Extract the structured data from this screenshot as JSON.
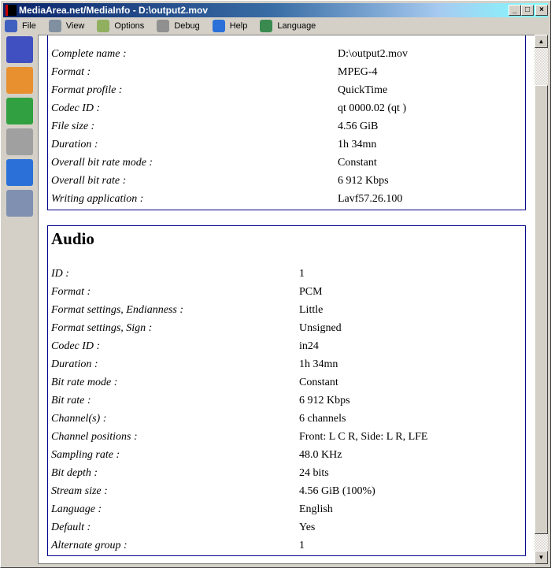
{
  "window": {
    "title": "MediaArea.net/MediaInfo - D:\\output2.mov",
    "minimize": "_",
    "maximize": "□",
    "close": "×"
  },
  "menu": [
    {
      "label": "File",
      "icon": "file-open-icon"
    },
    {
      "label": "View",
      "icon": "view-icon"
    },
    {
      "label": "Options",
      "icon": "options-icon"
    },
    {
      "label": "Debug",
      "icon": "debug-icon"
    },
    {
      "label": "Help",
      "icon": "help-icon"
    },
    {
      "label": "Language",
      "icon": "language-icon"
    }
  ],
  "toolbar": [
    "open-file-icon",
    "open-folder-icon",
    "export-icon",
    "preferences-icon",
    "about-icon",
    "knowledge-icon"
  ],
  "general": {
    "rows": [
      {
        "label": "Complete name :",
        "value": "D:\\output2.mov"
      },
      {
        "label": "Format :",
        "value": "MPEG-4"
      },
      {
        "label": "Format profile :",
        "value": "QuickTime"
      },
      {
        "label": "Codec ID :",
        "value": "qt 0000.02 (qt )"
      },
      {
        "label": "File size :",
        "value": "4.56 GiB"
      },
      {
        "label": "Duration :",
        "value": "1h 34mn"
      },
      {
        "label": "Overall bit rate mode :",
        "value": "Constant"
      },
      {
        "label": "Overall bit rate :",
        "value": "6 912 Kbps"
      },
      {
        "label": "Writing application :",
        "value": "Lavf57.26.100"
      }
    ]
  },
  "audio": {
    "heading": "Audio",
    "rows": [
      {
        "label": "ID :",
        "value": "1"
      },
      {
        "label": "Format :",
        "value": "PCM"
      },
      {
        "label": "Format settings, Endianness :",
        "value": "Little"
      },
      {
        "label": "Format settings, Sign :",
        "value": "Unsigned"
      },
      {
        "label": "Codec ID :",
        "value": "in24"
      },
      {
        "label": "Duration :",
        "value": "1h 34mn"
      },
      {
        "label": "Bit rate mode :",
        "value": "Constant"
      },
      {
        "label": "Bit rate :",
        "value": "6 912 Kbps"
      },
      {
        "label": "Channel(s) :",
        "value": "6 channels"
      },
      {
        "label": "Channel positions :",
        "value": "Front: L C R, Side: L R, LFE"
      },
      {
        "label": "Sampling rate :",
        "value": "48.0 KHz"
      },
      {
        "label": "Bit depth :",
        "value": "24 bits"
      },
      {
        "label": "Stream size :",
        "value": "4.56 GiB (100%)"
      },
      {
        "label": "Language :",
        "value": "English"
      },
      {
        "label": "Default :",
        "value": "Yes"
      },
      {
        "label": "Alternate group :",
        "value": "1"
      }
    ]
  }
}
